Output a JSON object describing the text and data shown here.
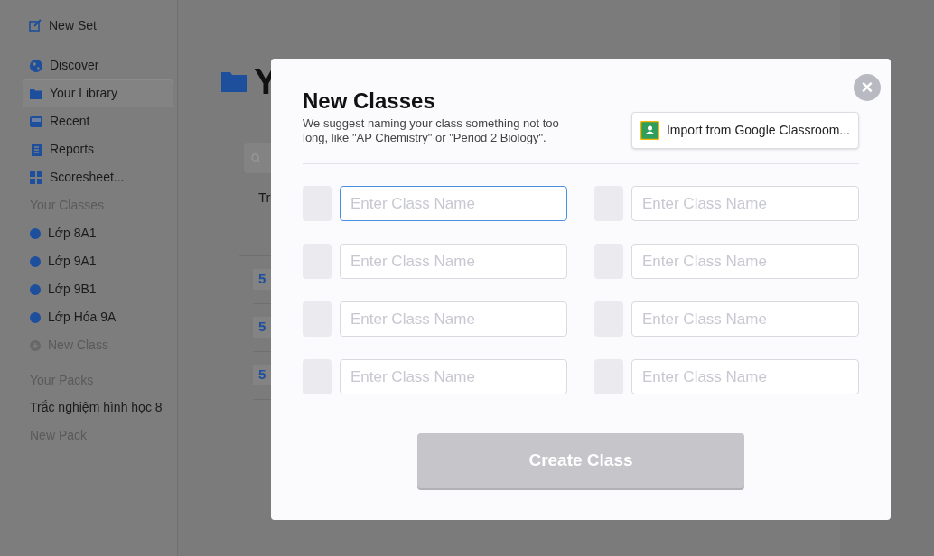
{
  "sidebar": {
    "new_set": "New Set",
    "nav": [
      {
        "label": "Discover",
        "kind": "globe",
        "selected": false
      },
      {
        "label": "Your Library",
        "kind": "folder",
        "selected": true
      },
      {
        "label": "Recent",
        "kind": "inbox",
        "selected": false
      },
      {
        "label": "Reports",
        "kind": "report",
        "selected": false
      },
      {
        "label": "Scoresheet...",
        "kind": "grid",
        "selected": false
      }
    ],
    "classes_heading": "Your Classes",
    "classes": [
      {
        "label": "Lớp 8A1",
        "color": "#1d4f9c"
      },
      {
        "label": "Lớp 9A1",
        "color": "#1d4f9c"
      },
      {
        "label": "Lớp 9B1",
        "color": "#1d4f9c"
      },
      {
        "label": "Lớp Hóa 9A",
        "color": "#1d4f9c"
      }
    ],
    "new_class": "New Class",
    "packs_heading": "Your Packs",
    "packs": [
      "Trắc nghiệm hình học 8"
    ],
    "new_pack": "New Pack"
  },
  "main": {
    "title": "Y",
    "column_1": "Tr",
    "rows": [
      "5",
      "5",
      "5"
    ]
  },
  "modal": {
    "title": "New Classes",
    "description": "We suggest naming your class something not too long, like \"AP Chemistry\" or \"Period 2 Biology\".",
    "import_button": "Import from Google Classroom...",
    "close": "×",
    "fields": [
      {
        "placeholder": "Enter Class Name",
        "focused": true
      },
      {
        "placeholder": "Enter Class Name",
        "focused": false
      },
      {
        "placeholder": "Enter Class Name",
        "focused": false
      },
      {
        "placeholder": "Enter Class Name",
        "focused": false
      },
      {
        "placeholder": "Enter Class Name",
        "focused": false
      },
      {
        "placeholder": "Enter Class Name",
        "focused": false
      },
      {
        "placeholder": "Enter Class Name",
        "focused": false
      },
      {
        "placeholder": "Enter Class Name",
        "focused": false
      }
    ],
    "create_button": "Create Class"
  }
}
